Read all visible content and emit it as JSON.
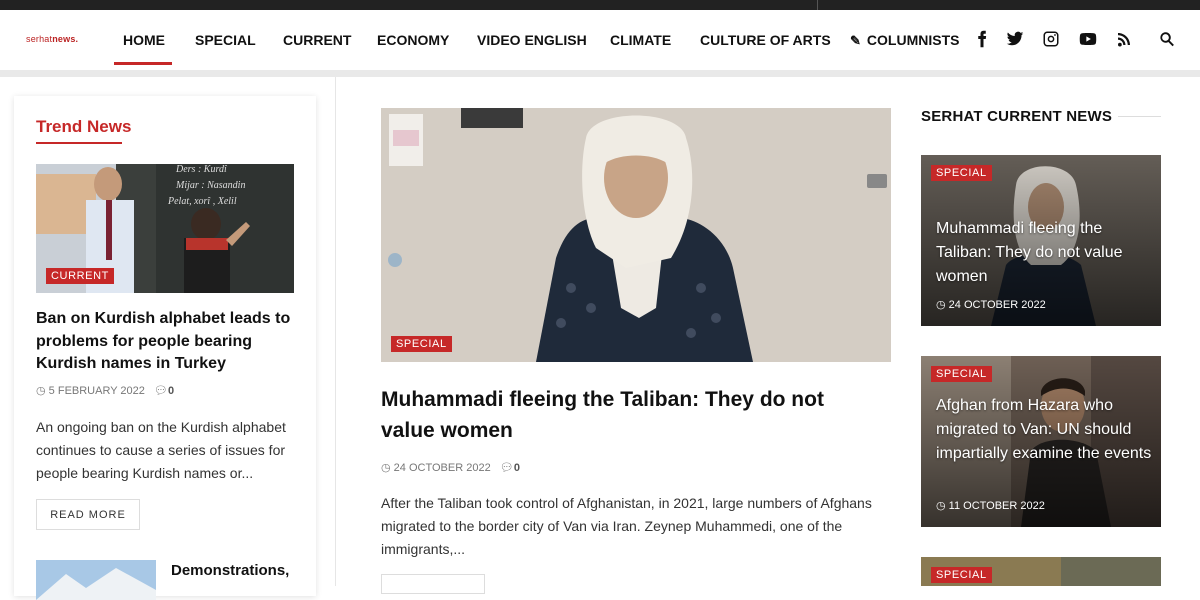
{
  "brand": {
    "logo_prefix": "serhat",
    "logo_suffix": "news."
  },
  "nav": {
    "items": [
      "HOME",
      "SPECIAL",
      "CURRENT",
      "ECONOMY",
      "VIDEO ENGLISH",
      "CLIMATE",
      "CULTURE OF ARTS",
      "COLUMNISTS"
    ],
    "active": "HOME",
    "social": [
      "facebook-icon",
      "twitter-icon",
      "instagram-icon",
      "youtube-icon",
      "rss-icon",
      "search-icon"
    ]
  },
  "trend": {
    "title": "Trend News",
    "article": {
      "badge": "CURRENT",
      "title": "Ban on Kurdish alphabet leads to problems for people bearing Kurdish names in Turkey",
      "date": "5 FEBRUARY 2022",
      "comments": "0",
      "excerpt": "An ongoing ban on the Kurdish alphabet continues to cause a series of issues for people bearing Kurdish names or...",
      "read_more": "READ MORE",
      "board_text": [
        "Ders : Kurdî",
        "Mijar : Nasandin",
        "Pelat, xorî , Xelil"
      ]
    },
    "next_title": "Demonstrations,"
  },
  "main": {
    "badge": "SPECIAL",
    "title": "Muhammadi fleeing the Taliban: They do not value women",
    "date": "24 OCTOBER 2022",
    "comments": "0",
    "excerpt": "After the Taliban took control of Afghanistan, in 2021, large numbers of Afghans migrated to the border city of Van via Iran. Zeynep Muhammedi, one of the immigrants,..."
  },
  "sidebar": {
    "title": "SERHAT CURRENT NEWS",
    "cards": [
      {
        "badge": "SPECIAL",
        "title": "Muhammadi fleeing the Taliban: They do not value women",
        "date": "24 OCTOBER 2022"
      },
      {
        "badge": "SPECIAL",
        "title": "Afghan from Hazara who migrated to Van: UN should impartially examine the events",
        "date": "11 OCTOBER 2022"
      },
      {
        "badge": "SPECIAL"
      }
    ]
  },
  "colors": {
    "accent": "#c62828",
    "text": "#111111",
    "muted": "#777777"
  }
}
